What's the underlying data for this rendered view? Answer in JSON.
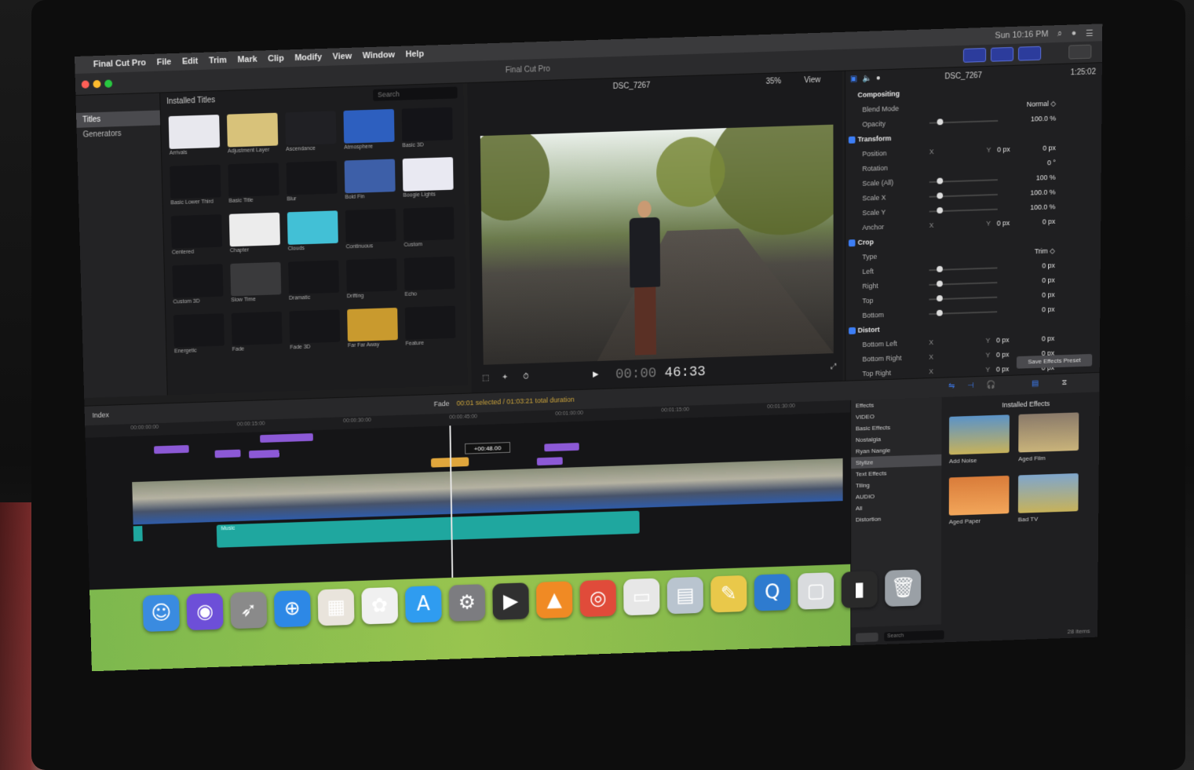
{
  "menubar": {
    "app": "Final Cut Pro",
    "menus": [
      "File",
      "Edit",
      "Trim",
      "Mark",
      "Clip",
      "Modify",
      "View",
      "Window",
      "Help"
    ],
    "clock": "Sun 10:16 PM"
  },
  "window": {
    "title": "Final Cut Pro"
  },
  "sidebar": {
    "items": [
      "Titles",
      "Generators"
    ]
  },
  "browser": {
    "header": "Installed Titles",
    "search_placeholder": "Search",
    "tiles": [
      "Arrivals",
      "Adjustment Layer",
      "Ascendance",
      "Atmosphere",
      "Basic 3D",
      "Basic Lower Third",
      "Basic Title",
      "Blur",
      "Bold Fin",
      "Boogie Lights",
      "Centered",
      "Chapter",
      "Clouds",
      "Continuous",
      "Custom",
      "Custom 3D",
      "Slow Time",
      "Dramatic",
      "Drifting",
      "Echo",
      "Energetic",
      "Fade",
      "Fade 3D",
      "Far Far Away",
      "Feature"
    ]
  },
  "viewer": {
    "clip_name": "DSC_7267",
    "zoom": "35%",
    "view_menu": "View",
    "timecode_prefix": "00:00",
    "timecode": "46:33"
  },
  "inspector": {
    "clip_name": "DSC_7267",
    "duration": "1:25:02",
    "rows": [
      {
        "type": "section",
        "label": "Compositing"
      },
      {
        "type": "row",
        "label": "Blend Mode",
        "value": "Normal ◇"
      },
      {
        "type": "slider",
        "label": "Opacity",
        "value": "100.0 %"
      },
      {
        "type": "section",
        "label": "Transform",
        "check": true
      },
      {
        "type": "xy",
        "label": "Position",
        "x": "X",
        "xv": "0 px",
        "y": "Y",
        "yv": "0 px"
      },
      {
        "type": "row",
        "label": "Rotation",
        "value": "0 °"
      },
      {
        "type": "slider",
        "label": "Scale (All)",
        "value": "100 %"
      },
      {
        "type": "slider",
        "label": "Scale X",
        "value": "100.0 %"
      },
      {
        "type": "slider",
        "label": "Scale Y",
        "value": "100.0 %"
      },
      {
        "type": "xy",
        "label": "Anchor",
        "x": "X",
        "xv": "0 px",
        "y": "Y",
        "yv": "0 px"
      },
      {
        "type": "section",
        "label": "Crop",
        "check": true
      },
      {
        "type": "row",
        "label": "Type",
        "value": "Trim ◇"
      },
      {
        "type": "slider",
        "label": "Left",
        "value": "0 px"
      },
      {
        "type": "slider",
        "label": "Right",
        "value": "0 px"
      },
      {
        "type": "slider",
        "label": "Top",
        "value": "0 px"
      },
      {
        "type": "slider",
        "label": "Bottom",
        "value": "0 px"
      },
      {
        "type": "section",
        "label": "Distort",
        "check": true
      },
      {
        "type": "xy",
        "label": "Bottom Left",
        "x": "X",
        "xv": "0 px",
        "y": "Y",
        "yv": "0 px"
      },
      {
        "type": "xy",
        "label": "Bottom Right",
        "x": "X",
        "xv": "0 px",
        "y": "Y",
        "yv": "0 px"
      },
      {
        "type": "xy",
        "label": "Top Right",
        "x": "X",
        "xv": "0 px",
        "y": "Y",
        "yv": "0 px"
      }
    ],
    "save_button": "Save Effects Preset"
  },
  "timeline": {
    "index_label": "Index",
    "project": "Fade",
    "duration_text": "00:01 selected / 01:03:21 total duration",
    "ruler": [
      "00:00:00:00",
      "00:00:15:00",
      "00:00:30:00",
      "00:00:45:00",
      "00:01:00:00",
      "00:01:15:00",
      "00:01:30:00"
    ],
    "playhead_tooltip": "+00:48.00",
    "audio_clip_name": "Music"
  },
  "effects": {
    "title": "Installed Effects",
    "categories": [
      {
        "label": "Effects",
        "sel": false
      },
      {
        "label": "VIDEO",
        "sel": false
      },
      {
        "label": "Basic Effects",
        "sel": false
      },
      {
        "label": "Nostalgia",
        "sel": false
      },
      {
        "label": "Ryan Nangle",
        "sel": false
      },
      {
        "label": "Stylize",
        "sel": true
      },
      {
        "label": "Text Effects",
        "sel": false
      },
      {
        "label": "Tiling",
        "sel": false
      },
      {
        "label": "AUDIO",
        "sel": false
      },
      {
        "label": "All",
        "sel": false
      },
      {
        "label": "Distortion",
        "sel": false
      }
    ],
    "items": [
      {
        "label": "Add Noise",
        "colors": [
          "#5b93c8",
          "#c7b25a"
        ]
      },
      {
        "label": "Aged Film",
        "colors": [
          "#8a7a6a",
          "#c9b37a"
        ]
      },
      {
        "label": "Aged Paper",
        "colors": [
          "#d97c3a",
          "#f2a65a"
        ]
      },
      {
        "label": "Bad TV",
        "colors": [
          "#7fa6cc",
          "#c7b25a"
        ]
      }
    ],
    "search_placeholder": "Search",
    "count": "28 items"
  },
  "dock": {
    "icons": [
      {
        "name": "finder-icon",
        "glyph": "☺",
        "color": "#3a8be0"
      },
      {
        "name": "siri-icon",
        "glyph": "◉",
        "color": "#6d4fd8"
      },
      {
        "name": "launchpad-icon",
        "glyph": "➶",
        "color": "#8a8a8a"
      },
      {
        "name": "safari-icon",
        "glyph": "⊕",
        "color": "#2d88e6"
      },
      {
        "name": "calendar-icon",
        "glyph": "▦",
        "color": "#e9e4dc"
      },
      {
        "name": "photos-icon",
        "glyph": "✿",
        "color": "#f0f0f0"
      },
      {
        "name": "app-store-icon",
        "glyph": "A",
        "color": "#2f9cf0"
      },
      {
        "name": "system-preferences-icon",
        "glyph": "⚙",
        "color": "#7c7c80"
      },
      {
        "name": "final-cut-pro-icon",
        "glyph": "▶",
        "color": "#303030"
      },
      {
        "name": "vlc-icon",
        "glyph": "▲",
        "color": "#f08a24"
      },
      {
        "name": "chrome-icon",
        "glyph": "◎",
        "color": "#e04b3a"
      },
      {
        "name": "preview-icon",
        "glyph": "▭",
        "color": "#e7e7e7"
      },
      {
        "name": "downloads-folder-icon",
        "glyph": "▤",
        "color": "#b9c4cf"
      },
      {
        "name": "notes-icon",
        "glyph": "✎",
        "color": "#e9c84a"
      },
      {
        "name": "quicktime-icon",
        "glyph": "Q",
        "color": "#2e7bcf"
      },
      {
        "name": "documents-folder-icon",
        "glyph": "▢",
        "color": "#d9dbde"
      },
      {
        "name": "terminal-icon",
        "glyph": "▮",
        "color": "#2a2a2a"
      },
      {
        "name": "trash-icon",
        "glyph": "🗑",
        "color": "#9aa0a6"
      }
    ]
  }
}
